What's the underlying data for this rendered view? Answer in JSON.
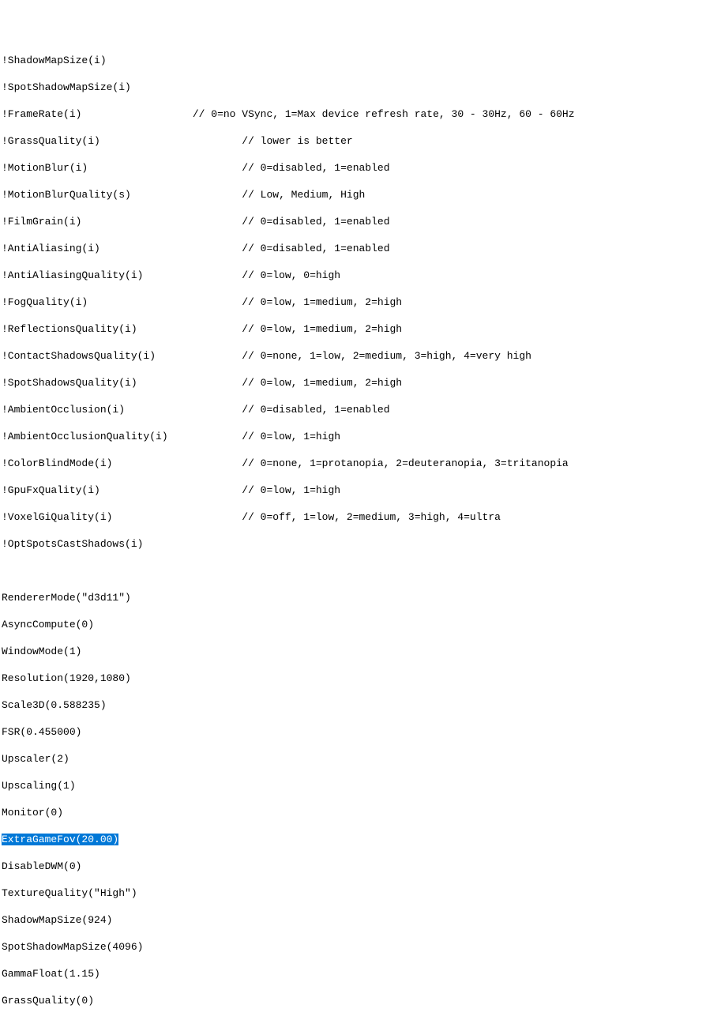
{
  "declarations": [
    {
      "text": "!ShadowMapSize(i)",
      "comment": ""
    },
    {
      "text": "!SpotShadowMapSize(i)",
      "comment": ""
    },
    {
      "text": "!FrameRate(i)",
      "pad": "                  ",
      "comment": "// 0=no VSync, 1=Max device refresh rate, 30 - 30Hz, 60 - 60Hz"
    },
    {
      "text": "!GrassQuality(i)",
      "pad": "                       ",
      "comment": "// lower is better"
    },
    {
      "text": "!MotionBlur(i)",
      "pad": "                         ",
      "comment": "// 0=disabled, 1=enabled"
    },
    {
      "text": "!MotionBlurQuality(s)",
      "pad": "                  ",
      "comment": "// Low, Medium, High"
    },
    {
      "text": "!FilmGrain(i)",
      "pad": "                          ",
      "comment": "// 0=disabled, 1=enabled"
    },
    {
      "text": "!AntiAliasing(i)",
      "pad": "                       ",
      "comment": "// 0=disabled, 1=enabled"
    },
    {
      "text": "!AntiAliasingQuality(i)",
      "pad": "                ",
      "comment": "// 0=low, 0=high"
    },
    {
      "text": "!FogQuality(i)",
      "pad": "                         ",
      "comment": "// 0=low, 1=medium, 2=high"
    },
    {
      "text": "!ReflectionsQuality(i)",
      "pad": "                 ",
      "comment": "// 0=low, 1=medium, 2=high"
    },
    {
      "text": "!ContactShadowsQuality(i)",
      "pad": "              ",
      "comment": "// 0=none, 1=low, 2=medium, 3=high, 4=very high"
    },
    {
      "text": "!SpotShadowsQuality(i)",
      "pad": "                 ",
      "comment": "// 0=low, 1=medium, 2=high"
    },
    {
      "text": "!AmbientOcclusion(i)",
      "pad": "                   ",
      "comment": "// 0=disabled, 1=enabled"
    },
    {
      "text": "!AmbientOcclusionQuality(i)",
      "pad": "            ",
      "comment": "// 0=low, 1=high"
    },
    {
      "text": "!ColorBlindMode(i)",
      "pad": "                     ",
      "comment": "// 0=none, 1=protanopia, 2=deuteranopia, 3=tritanopia"
    },
    {
      "text": "!GpuFxQuality(i)",
      "pad": "                       ",
      "comment": "// 0=low, 1=high"
    },
    {
      "text": "!VoxelGiQuality(i)",
      "pad": "                     ",
      "comment": "// 0=off, 1=low, 2=medium, 3=high, 4=ultra"
    },
    {
      "text": "!OptSpotsCastShadows(i)",
      "comment": ""
    }
  ],
  "blank": " ",
  "settings": [
    {
      "text": "RendererMode(\"d3d11\")",
      "highlight": false
    },
    {
      "text": "AsyncCompute(0)",
      "highlight": false
    },
    {
      "text": "WindowMode(1)",
      "highlight": false
    },
    {
      "text": "Resolution(1920,1080)",
      "highlight": false
    },
    {
      "text": "Scale3D(0.588235)",
      "highlight": false
    },
    {
      "text": "FSR(0.455000)",
      "highlight": false
    },
    {
      "text": "Upscaler(2)",
      "highlight": false
    },
    {
      "text": "Upscaling(1)",
      "highlight": false
    },
    {
      "text": "Monitor(0)",
      "highlight": false
    },
    {
      "text": "ExtraGameFov(20.00)",
      "highlight": true
    },
    {
      "text": "DisableDWM(0)",
      "highlight": false
    },
    {
      "text": "TextureQuality(\"High\")",
      "highlight": false
    },
    {
      "text": "ShadowMapSize(924)",
      "highlight": false
    },
    {
      "text": "SpotShadowMapSize(4096)",
      "highlight": false
    },
    {
      "text": "GammaFloat(1.15)",
      "highlight": false
    },
    {
      "text": "GrassQuality(0)",
      "highlight": false
    }
  ]
}
